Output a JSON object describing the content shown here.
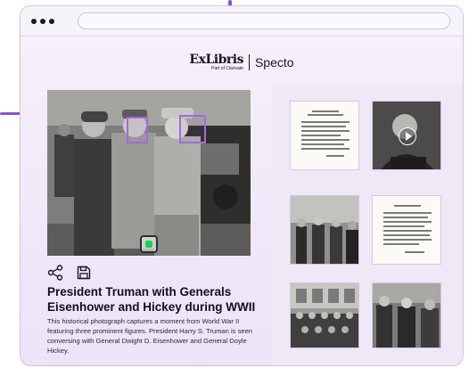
{
  "brand": {
    "logo_text": "ExLibris",
    "logo_subtext": "Part of Clarivate",
    "product_name": "Specto"
  },
  "browser": {
    "address_value": ""
  },
  "main_photo": {
    "face_boxes": 2
  },
  "actions": {
    "icons": [
      "share-icon",
      "save-icon"
    ]
  },
  "article": {
    "title": "President Truman with Generals Eisenhower and Hickey during WWII",
    "description": "This historical photograph captures a moment from World War II featuring three prominent figures. President Harry S. Truman is seen conversing with General Dwight D. Eisenhower and General Doyle Hickey."
  },
  "thumbnails": [
    {
      "type": "document"
    },
    {
      "type": "video"
    },
    {
      "type": "photo"
    },
    {
      "type": "document"
    },
    {
      "type": "photo"
    },
    {
      "type": "photo"
    }
  ],
  "colors": {
    "accent": "#a56ad9",
    "background": "#f2ebf9",
    "scan_green": "#1fd04f"
  }
}
